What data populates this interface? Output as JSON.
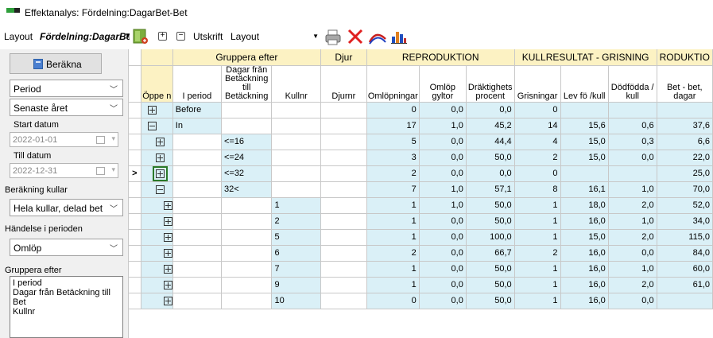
{
  "window": {
    "title": "Effektanalys: Fördelning:DagarBet-Bet"
  },
  "toolbar": {
    "layout_label": "Layout",
    "layout_value": "Fördelning:DagarBet-Bet",
    "print_label": "Utskrift",
    "layout_select": "Layout"
  },
  "left": {
    "calc_button": "Beräkna",
    "period_type": "Period",
    "period_value": "Senaste året",
    "start_label": "Start datum",
    "start_value": "2022-01-01",
    "end_label": "Till datum",
    "end_value": "2022-12-31",
    "litter_calc_label": "Beräkning kullar",
    "litter_calc_value": "Hela kullar, delad bet",
    "event_label": "Händelse i perioden",
    "event_value": "Omlöp",
    "group_label": "Gruppera efter",
    "group_items": [
      "I period",
      "Dagar från Betäckning till Bet",
      "Kullnr"
    ]
  },
  "grid": {
    "group_headers": {
      "gruppera": "Gruppera efter",
      "djur": "Djur",
      "reproduktion": "REPRODUKTION",
      "kullresultat": "KULLRESULTAT - GRISNING",
      "reproduktio2": "RODUKTIO"
    },
    "columns": {
      "open": "Öppe n",
      "i_period": "I period",
      "dagar": "Dagar från Betäckning till Betäckning",
      "kullnr": "Kullnr",
      "djurnr": "Djurnr",
      "omlopningar": "Omlöpningar",
      "omlop_gyltor": "Omlöp gyltor",
      "draktighet": "Dräktighets procent",
      "grisningar": "Grisningar",
      "lev_fo": "Lev fö /kull",
      "dodfodda": "Dödfödda / kull",
      "bet_bet": "Bet - bet, dagar"
    },
    "rows": [
      {
        "node": "plus",
        "indent": 0,
        "i_period": "Before",
        "dagar": "",
        "kullnr": "",
        "omlopningar": "0",
        "omlop_gyltor": "0,0",
        "draktighet": "0,0",
        "grisningar": "0",
        "lev_fo": "",
        "dodfodda": "",
        "bet_bet": "",
        "blue": true
      },
      {
        "node": "minus",
        "indent": 0,
        "i_period": "In",
        "dagar": "",
        "kullnr": "",
        "omlopningar": "17",
        "omlop_gyltor": "1,0",
        "draktighet": "45,2",
        "grisningar": "14",
        "lev_fo": "15,6",
        "dodfodda": "0,6",
        "bet_bet": "37,6",
        "blue": true
      },
      {
        "node": "plus",
        "indent": 1,
        "i_period": "",
        "dagar": "<=16",
        "kullnr": "",
        "omlopningar": "5",
        "omlop_gyltor": "0,0",
        "draktighet": "44,4",
        "grisningar": "4",
        "lev_fo": "15,0",
        "dodfodda": "0,3",
        "bet_bet": "6,6",
        "blue": true
      },
      {
        "node": "plus",
        "indent": 1,
        "i_period": "",
        "dagar": "<=24",
        "kullnr": "",
        "omlopningar": "3",
        "omlop_gyltor": "0,0",
        "draktighet": "50,0",
        "grisningar": "2",
        "lev_fo": "15,0",
        "dodfodda": "0,0",
        "bet_bet": "22,0",
        "blue": true
      },
      {
        "node": "plus",
        "indent": 1,
        "i_period": "",
        "dagar": "<=32",
        "kullnr": "",
        "omlopningar": "2",
        "omlop_gyltor": "0,0",
        "draktighet": "0,0",
        "grisningar": "0",
        "lev_fo": "",
        "dodfodda": "",
        "bet_bet": "25,0",
        "blue": true,
        "current": true
      },
      {
        "node": "minus",
        "indent": 1,
        "i_period": "",
        "dagar": "32<",
        "kullnr": "",
        "omlopningar": "7",
        "omlop_gyltor": "1,0",
        "draktighet": "57,1",
        "grisningar": "8",
        "lev_fo": "16,1",
        "dodfodda": "1,0",
        "bet_bet": "70,0",
        "blue": true
      },
      {
        "node": "plus",
        "indent": 2,
        "i_period": "",
        "dagar": "",
        "kullnr": "1",
        "omlopningar": "1",
        "omlop_gyltor": "1,0",
        "draktighet": "50,0",
        "grisningar": "1",
        "lev_fo": "18,0",
        "dodfodda": "2,0",
        "bet_bet": "52,0",
        "blue": true
      },
      {
        "node": "plus",
        "indent": 2,
        "i_period": "",
        "dagar": "",
        "kullnr": "2",
        "omlopningar": "1",
        "omlop_gyltor": "0,0",
        "draktighet": "50,0",
        "grisningar": "1",
        "lev_fo": "16,0",
        "dodfodda": "1,0",
        "bet_bet": "34,0",
        "blue": true
      },
      {
        "node": "plus",
        "indent": 2,
        "i_period": "",
        "dagar": "",
        "kullnr": "5",
        "omlopningar": "1",
        "omlop_gyltor": "0,0",
        "draktighet": "100,0",
        "grisningar": "1",
        "lev_fo": "15,0",
        "dodfodda": "2,0",
        "bet_bet": "115,0",
        "blue": true
      },
      {
        "node": "plus",
        "indent": 2,
        "i_period": "",
        "dagar": "",
        "kullnr": "6",
        "omlopningar": "2",
        "omlop_gyltor": "0,0",
        "draktighet": "66,7",
        "grisningar": "2",
        "lev_fo": "16,0",
        "dodfodda": "0,0",
        "bet_bet": "84,0",
        "blue": true
      },
      {
        "node": "plus",
        "indent": 2,
        "i_period": "",
        "dagar": "",
        "kullnr": "7",
        "omlopningar": "1",
        "omlop_gyltor": "0,0",
        "draktighet": "50,0",
        "grisningar": "1",
        "lev_fo": "16,0",
        "dodfodda": "1,0",
        "bet_bet": "60,0",
        "blue": true
      },
      {
        "node": "plus",
        "indent": 2,
        "i_period": "",
        "dagar": "",
        "kullnr": "9",
        "omlopningar": "1",
        "omlop_gyltor": "0,0",
        "draktighet": "50,0",
        "grisningar": "1",
        "lev_fo": "16,0",
        "dodfodda": "2,0",
        "bet_bet": "61,0",
        "blue": true
      },
      {
        "node": "plus",
        "indent": 2,
        "i_period": "",
        "dagar": "",
        "kullnr": "10",
        "omlopningar": "0",
        "omlop_gyltor": "0,0",
        "draktighet": "50,0",
        "grisningar": "1",
        "lev_fo": "16,0",
        "dodfodda": "0,0",
        "bet_bet": "",
        "blue": true
      }
    ],
    "current_row_marker": ">"
  },
  "colors": {
    "header_yellow": "#fcf2c3",
    "row_blue": "#daf0f7",
    "accent_green": "#2e9e3a"
  }
}
